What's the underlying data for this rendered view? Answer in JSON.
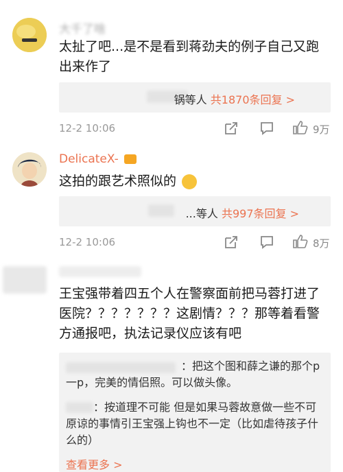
{
  "comments": [
    {
      "username": "大千了啥",
      "text": "太扯了吧...是不是看到蒋劲夫的例子自己又跑出来作了",
      "reply_preview": "锅等人",
      "reply_count": "共1870条回复 >",
      "timestamp": "12-2 10:06",
      "likes": "9万"
    },
    {
      "username": "DelicateX-",
      "username_color": "#eb7350",
      "text": "这拍的跟艺术照似的",
      "reply_preview": "...等人",
      "reply_count": "共997条回复 >",
      "timestamp": "12-2 10:06",
      "likes": "8万"
    },
    {
      "text": "王宝强带着四五个人在警察面前把马蓉打进了医院？？？？？？？这剧情？？？那等着看警方通报吧，执法记录仪应该有吧",
      "replies": [
        {
          "text": "：把这个图和薛之谦的那个p一p，完美的情侣照。可以做头像。"
        },
        {
          "text": "：按道理不可能 但是如果马蓉故意做一些不可原谅的事情引王宝强上钩也不一定（比如虐待孩子什么的）"
        }
      ],
      "see_more": "查看更多 >"
    }
  ]
}
